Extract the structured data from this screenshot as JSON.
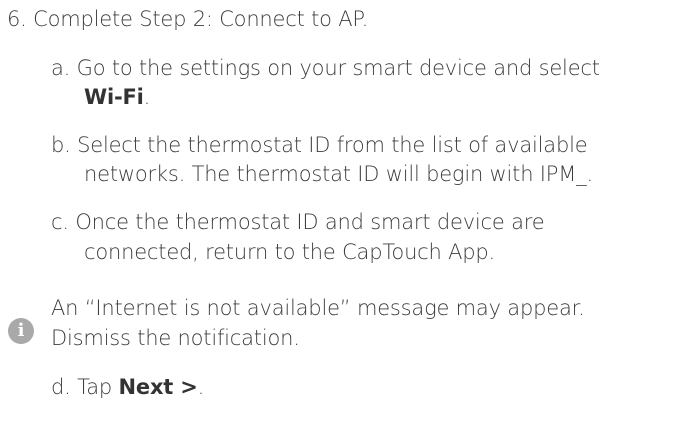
{
  "step": {
    "marker": "6.",
    "text": "Complete Step 2: Connect to AP."
  },
  "substeps": {
    "a": {
      "marker": "a.",
      "line1": "Go to the settings on your smart device and select",
      "bold": "Wi-Fi",
      "suffix": "."
    },
    "b": {
      "marker": "b.",
      "line1": "Select the thermostat ID from the list of available",
      "line2": "networks. The thermostat ID will begin with IPM_."
    },
    "c": {
      "marker": "c.",
      "line1": "Once the thermostat ID and smart device are",
      "line2": "connected, return to the CapTouch App."
    },
    "d": {
      "marker": "d.",
      "prefix": "Tap ",
      "bold": "Next >",
      "suffix": "."
    }
  },
  "note": {
    "icon": "info-icon",
    "line1": "An “Internet is not available” message may appear.",
    "line2": "Dismiss the notification."
  }
}
